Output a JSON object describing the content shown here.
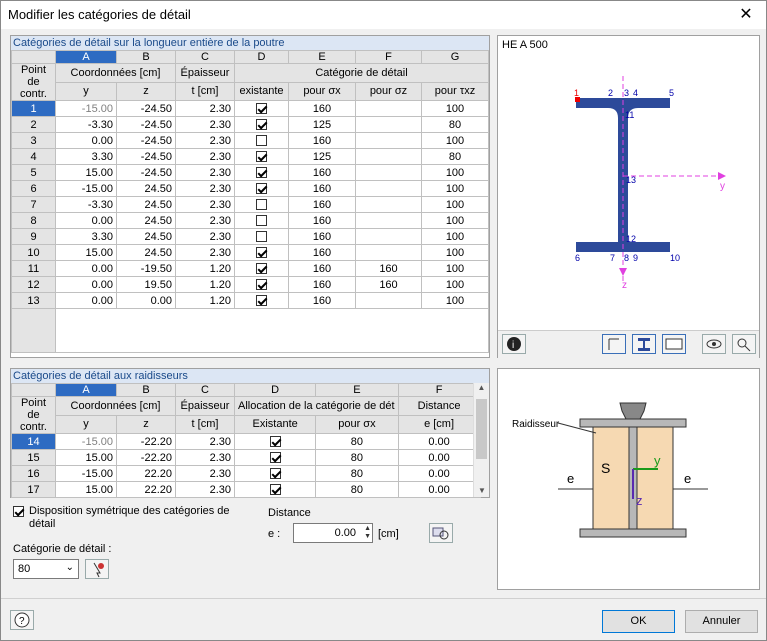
{
  "window": {
    "title": "Modifier les catégories de détail"
  },
  "table1": {
    "title": "Catégories de détail sur la longueur entière de la poutre",
    "letters": [
      "A",
      "B",
      "C",
      "D",
      "E",
      "F",
      "G"
    ],
    "h_point": "Point de contr.",
    "h_coord": "Coordonnées [cm]",
    "h_epais": "Épaisseur",
    "h_cat": "Catégorie de détail",
    "h_y": "y",
    "h_z": "z",
    "h_t": "t [cm]",
    "h_exist": "existante",
    "h_sx": "pour σx",
    "h_sz": "pour σz",
    "h_txz": "pour τxz",
    "rows": [
      {
        "n": "1",
        "y": "-15.00",
        "z": "-24.50",
        "t": "2.30",
        "ex": true,
        "sx": "160",
        "sz": "",
        "txz": "100"
      },
      {
        "n": "2",
        "y": "-3.30",
        "z": "-24.50",
        "t": "2.30",
        "ex": true,
        "sx": "125",
        "sz": "",
        "txz": "80"
      },
      {
        "n": "3",
        "y": "0.00",
        "z": "-24.50",
        "t": "2.30",
        "ex": false,
        "sx": "160",
        "sz": "",
        "txz": "100"
      },
      {
        "n": "4",
        "y": "3.30",
        "z": "-24.50",
        "t": "2.30",
        "ex": true,
        "sx": "125",
        "sz": "",
        "txz": "80"
      },
      {
        "n": "5",
        "y": "15.00",
        "z": "-24.50",
        "t": "2.30",
        "ex": true,
        "sx": "160",
        "sz": "",
        "txz": "100"
      },
      {
        "n": "6",
        "y": "-15.00",
        "z": "24.50",
        "t": "2.30",
        "ex": true,
        "sx": "160",
        "sz": "",
        "txz": "100"
      },
      {
        "n": "7",
        "y": "-3.30",
        "z": "24.50",
        "t": "2.30",
        "ex": false,
        "sx": "160",
        "sz": "",
        "txz": "100"
      },
      {
        "n": "8",
        "y": "0.00",
        "z": "24.50",
        "t": "2.30",
        "ex": false,
        "sx": "160",
        "sz": "",
        "txz": "100"
      },
      {
        "n": "9",
        "y": "3.30",
        "z": "24.50",
        "t": "2.30",
        "ex": false,
        "sx": "160",
        "sz": "",
        "txz": "100"
      },
      {
        "n": "10",
        "y": "15.00",
        "z": "24.50",
        "t": "2.30",
        "ex": true,
        "sx": "160",
        "sz": "",
        "txz": "100"
      },
      {
        "n": "11",
        "y": "0.00",
        "z": "-19.50",
        "t": "1.20",
        "ex": true,
        "sx": "160",
        "sz": "160",
        "txz": "100"
      },
      {
        "n": "12",
        "y": "0.00",
        "z": "19.50",
        "t": "1.20",
        "ex": true,
        "sx": "160",
        "sz": "160",
        "txz": "100"
      },
      {
        "n": "13",
        "y": "0.00",
        "z": "0.00",
        "t": "1.20",
        "ex": true,
        "sx": "160",
        "sz": "",
        "txz": "100"
      }
    ]
  },
  "table2": {
    "title": "Catégories de détail aux raidisseurs",
    "letters": [
      "A",
      "B",
      "C",
      "D",
      "E",
      "F"
    ],
    "h_point": "Point de contr.",
    "h_coord": "Coordonnées [cm]",
    "h_epais": "Épaisseur",
    "h_alloc": "Allocation de la catégorie de dét",
    "h_dist": "Distance",
    "h_y": "y",
    "h_z": "z",
    "h_t": "t [cm]",
    "h_exist": "Existante",
    "h_sx": "pour σx",
    "h_e": "e [cm]",
    "rows": [
      {
        "n": "14",
        "y": "-15.00",
        "z": "-22.20",
        "t": "2.30",
        "ex": true,
        "sx": "80",
        "e": "0.00"
      },
      {
        "n": "15",
        "y": "15.00",
        "z": "-22.20",
        "t": "2.30",
        "ex": true,
        "sx": "80",
        "e": "0.00"
      },
      {
        "n": "16",
        "y": "-15.00",
        "z": "22.20",
        "t": "2.30",
        "ex": true,
        "sx": "80",
        "e": "0.00"
      },
      {
        "n": "17",
        "y": "15.00",
        "z": "22.20",
        "t": "2.30",
        "ex": true,
        "sx": "80",
        "e": "0.00"
      }
    ]
  },
  "options": {
    "symmetric_label": "Disposition symétrique des catégories de détail",
    "symmetric_checked": true,
    "category_label": "Catégorie de détail :",
    "category_value": "80",
    "distance_label": "Distance",
    "e_label": "e :",
    "e_value": "0.00",
    "e_unit": "[cm]"
  },
  "preview": {
    "section": "HE A 500",
    "points_top": [
      "1",
      "2",
      "3",
      "4",
      "5"
    ],
    "points_bottom": [
      "6",
      "7",
      "8",
      "9",
      "10"
    ],
    "point_mid": "13",
    "point_11": "11",
    "point_12": "12",
    "axis_y": "y",
    "axis_z": "z"
  },
  "stiffener": {
    "label": "Raidisseur",
    "s": "S",
    "y": "y",
    "z": "z",
    "e": "e"
  },
  "buttons": {
    "ok": "OK",
    "cancel": "Annuler"
  }
}
